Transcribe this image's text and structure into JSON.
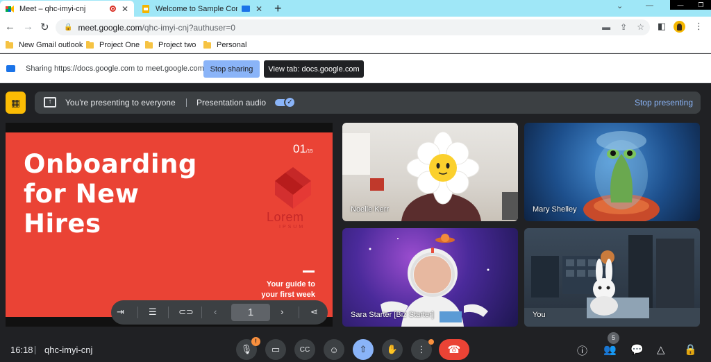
{
  "browser": {
    "tabs": [
      {
        "title": "Meet – qhc-imyi-cnj",
        "active": true
      },
      {
        "title": "Welcome to Sample Compar",
        "active": false
      }
    ],
    "url_host": "meet.google.com",
    "url_path": "/qhc-imyi-cnj?authuser=0",
    "bookmarks": [
      "New Gmail outlook",
      "Project One",
      "Project two",
      "Personal"
    ]
  },
  "sharing_bar": {
    "text": "Sharing https://docs.google.com to meet.google.com",
    "stop_label": "Stop sharing",
    "view_label": "View tab: docs.google.com"
  },
  "presenting_bar": {
    "status": "You're presenting to everyone",
    "audio_label": "Presentation audio",
    "audio_on": true,
    "stop_label": "Stop presenting"
  },
  "slide": {
    "title_lines": [
      "Onboarding",
      "for New",
      "Hires"
    ],
    "page": "01",
    "page_total": "/15",
    "logo_text": "Lorem",
    "logo_sub": "IPSUM",
    "tagline_1": "Your guide to",
    "tagline_2": "your first week",
    "current_page": "1"
  },
  "participants": [
    {
      "name": "Noelle Kerr"
    },
    {
      "name": "Mary Shelley"
    },
    {
      "name": "Sara Starter [Biz Starter]"
    },
    {
      "name": "You"
    }
  ],
  "meeting": {
    "time": "16:18",
    "code": "qhc-imyi-cnj",
    "participant_count": "5"
  },
  "colors": {
    "slide_red": "#ea4335",
    "accent_blue": "#8ab4f8",
    "hangup_red": "#ea4335",
    "warn_orange": "#fa903e"
  }
}
